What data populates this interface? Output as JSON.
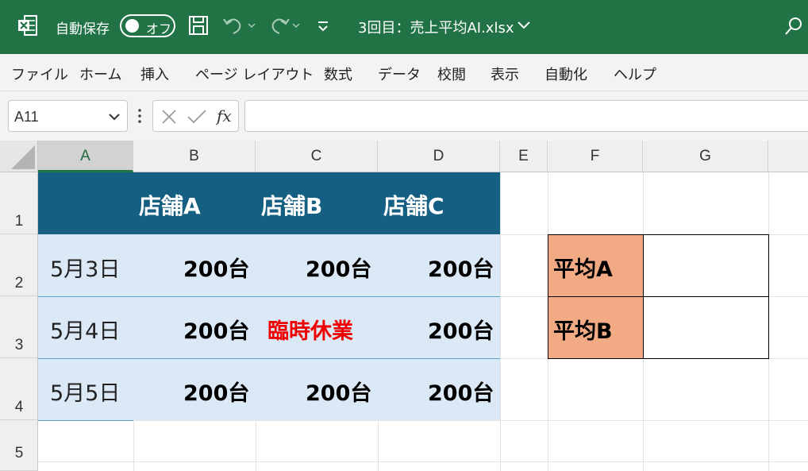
{
  "titlebar": {
    "autosave_label": "自動保存",
    "toggle_label": "オフ",
    "filename": "3回目：売上平均AI.xlsx",
    "icons": [
      "excel-logo-icon",
      "save-icon",
      "undo-icon",
      "redo-icon",
      "customize-qat-icon",
      "search-icon"
    ],
    "bg_color": "#217346"
  },
  "menu": [
    "ファイル",
    "ホーム",
    "挿入",
    "ページ レイアウト",
    "数式",
    "データ",
    "校閲",
    "表示",
    "自動化",
    "ヘルプ"
  ],
  "formula_bar": {
    "name_box": "A11",
    "formula": ""
  },
  "sheet": {
    "columns": [
      "A",
      "B",
      "C",
      "D",
      "E",
      "F",
      "G"
    ],
    "rows": [
      "1",
      "2",
      "3",
      "4",
      "5"
    ],
    "header_row": [
      "店舗A",
      "店舗B",
      "店舗C"
    ],
    "data": [
      {
        "date": "5月3日",
        "a": "200台",
        "b": "200台",
        "c": "200台"
      },
      {
        "date": "5月4日",
        "a": "200台",
        "b": "臨時休業",
        "c": "200台"
      },
      {
        "date": "5月5日",
        "a": "200台",
        "b": "200台",
        "c": "200台"
      }
    ],
    "avg_labels": [
      "平均A",
      "平均B"
    ],
    "colors": {
      "header_fill": "#145f82",
      "data_fill": "#dbe9f7",
      "avg_fill": "#f2aa84",
      "closed_text": "#ee0000"
    }
  }
}
